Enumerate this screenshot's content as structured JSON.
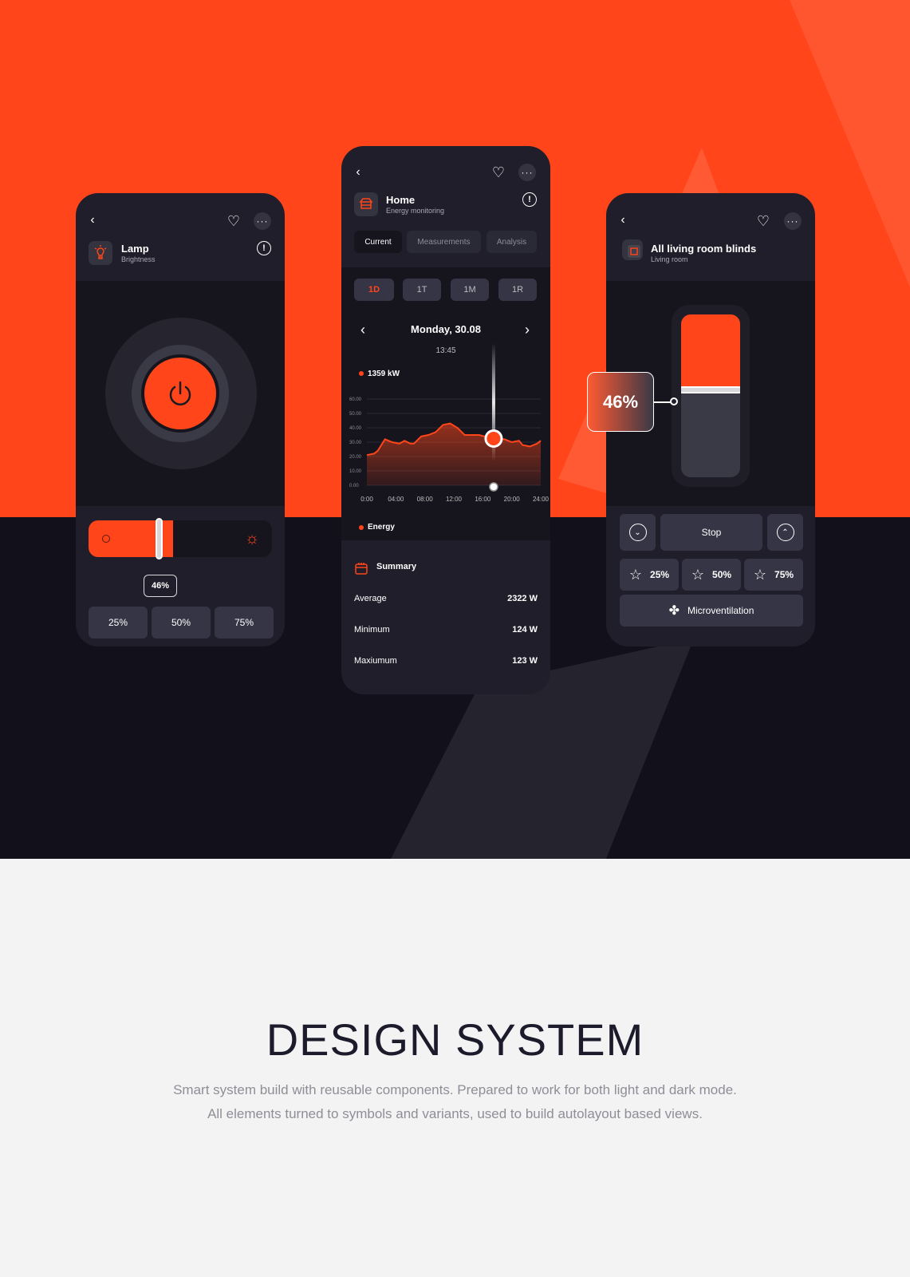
{
  "colors": {
    "accent": "#ff4519",
    "phone_bg": "#1f1e2a",
    "dark": "#12111b",
    "light": "#f3f3f3"
  },
  "lamp": {
    "title": "Lamp",
    "subtitle": "Brightness",
    "brightness_percent": 46,
    "value_label": "46%",
    "presets": [
      "25%",
      "50%",
      "75%"
    ],
    "icons": [
      "chevron-left-icon",
      "heart-icon",
      "more-icon",
      "lightbulb-icon",
      "info-icon",
      "power-icon",
      "sun-icon"
    ]
  },
  "home": {
    "title": "Home",
    "subtitle": "Energy monitoring",
    "tabs": [
      "Current",
      "Measurements",
      "Analysis"
    ],
    "active_tab": "Current",
    "ranges": [
      "1D",
      "1T",
      "1M",
      "1R"
    ],
    "active_range": "1D",
    "date": "Monday, 30.08",
    "time": "13:45",
    "reading": "1359 kW",
    "legend": "Energy",
    "summary": {
      "title": "Summary",
      "rows": [
        {
          "label": "Average",
          "value": "2322 W"
        },
        {
          "label": "Minimum",
          "value": "124 W"
        },
        {
          "label": "Maxiumum",
          "value": "123 W"
        }
      ]
    }
  },
  "chart_data": {
    "type": "area",
    "x": [
      0,
      1,
      1.5,
      2.5,
      3.5,
      4.5,
      5.2,
      6,
      6.5,
      7.5,
      8.5,
      9.5,
      10.5,
      11.5,
      12.5,
      13.5,
      14.5,
      15.5,
      17,
      18,
      19,
      20,
      21,
      21.5,
      22.5,
      23.5,
      24
    ],
    "values": [
      21,
      22,
      24,
      32,
      30,
      29,
      31,
      29,
      29,
      34,
      35,
      37,
      42,
      43,
      40,
      35,
      35,
      35,
      33,
      32,
      32,
      30,
      31,
      28,
      27,
      29,
      31
    ],
    "xlim": [
      0,
      24
    ],
    "ylim": [
      0,
      60
    ],
    "xticks": [
      "0:00",
      "04:00",
      "08:00",
      "12:00",
      "16:00",
      "20:00",
      "24:00"
    ],
    "yticks": [
      "60.00",
      "50.00",
      "40.00",
      "30.00",
      "20.00",
      "10.00",
      "0.00"
    ],
    "grid": true,
    "marker_x": 17.5,
    "series_color": "#ff4519"
  },
  "blinds": {
    "title": "All living room blinds",
    "subtitle": "Living room",
    "position_percent": 46,
    "value_label": "46%",
    "stop": "Stop",
    "presets": [
      "25%",
      "50%",
      "75%"
    ],
    "micro": "Microventilation"
  },
  "footer": {
    "heading": "DESIGN SYSTEM",
    "line1": "Smart system build with reusable components. Prepared to work for both light and dark mode.",
    "line2": "All elements turned to symbols and variants, used to build autolayout based views."
  }
}
